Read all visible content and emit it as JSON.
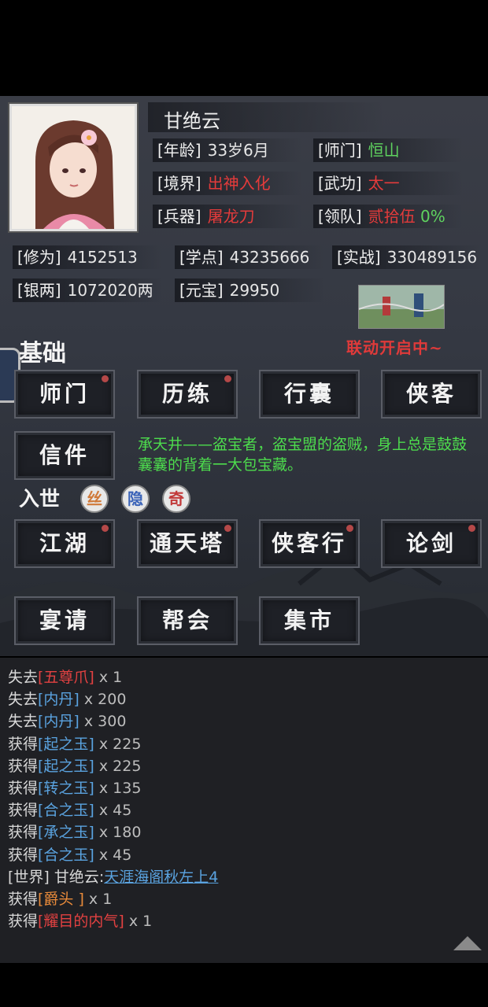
{
  "profile": {
    "name": "甘绝云",
    "stats": {
      "age": {
        "label": "[年龄]",
        "value": "33岁6月"
      },
      "sect": {
        "label": "[师门]",
        "value": "恒山"
      },
      "realm": {
        "label": "[境界]",
        "value": "出神入化"
      },
      "martial": {
        "label": "[武功]",
        "value": "太一"
      },
      "weapon": {
        "label": "[兵器]",
        "value": "屠龙刀"
      },
      "team": {
        "label": "[领队]",
        "value": "贰拾伍",
        "extra": "0%"
      },
      "cultivation": {
        "label": "[修为]",
        "value": "4152513"
      },
      "study": {
        "label": "[学点]",
        "value": "43235666"
      },
      "combat": {
        "label": "[实战]",
        "value": "330489156"
      },
      "silver": {
        "label": "[银两]",
        "value": "1072020两"
      },
      "yuanbao": {
        "label": "[元宝]",
        "value": "29950"
      }
    }
  },
  "event": {
    "text": "联动开启中~"
  },
  "basic": {
    "title": "基础",
    "buttons": [
      "师门",
      "历练",
      "行囊",
      "侠客",
      "信件"
    ]
  },
  "notice": "承天井——盗宝者，盗宝盟的盗贼，身上总是鼓鼓囊囊的背着一大包宝藏。",
  "world": {
    "title": "入世",
    "badges": [
      "丝",
      "隐",
      "奇"
    ],
    "buttons": [
      "江湖",
      "通天塔",
      "侠客行",
      "论剑",
      "宴请",
      "帮会",
      "集市"
    ]
  },
  "log": [
    {
      "prefix": "失去",
      "item": "[五尊爪]",
      "qty": " x 1"
    },
    {
      "prefix": "失去",
      "item": "[内丹]",
      "qty": " x 200"
    },
    {
      "prefix": "失去",
      "item": "[内丹]",
      "qty": " x 300"
    },
    {
      "prefix": "获得",
      "item": "[起之玉]",
      "qty": " x 225"
    },
    {
      "prefix": "获得",
      "item": "[起之玉]",
      "qty": " x 225"
    },
    {
      "prefix": "获得",
      "item": "[转之玉]",
      "qty": " x 135"
    },
    {
      "prefix": "获得",
      "item": "[合之玉]",
      "qty": " x 45"
    },
    {
      "prefix": "获得",
      "item": "[承之玉]",
      "qty": " x 180"
    },
    {
      "prefix": "获得",
      "item": "[合之玉]",
      "qty": " x 45"
    },
    {
      "prefix": "[世界] 甘绝云:",
      "item": "天涯海阁秋左上4",
      "qty": ""
    },
    {
      "prefix": "获得",
      "item": "[爵头 ]",
      "qty": " x 1"
    },
    {
      "prefix": "获得",
      "item": "[耀目的内气]",
      "qty": " x 1"
    }
  ],
  "colors": {
    "red": "#e43b3b",
    "green": "#5fd35f",
    "blue": "#5aa3e0",
    "orange": "#e88a3a"
  },
  "icons": {
    "scroll_up": "triangle-up-icon",
    "side_tab": "side-tab-icon"
  }
}
